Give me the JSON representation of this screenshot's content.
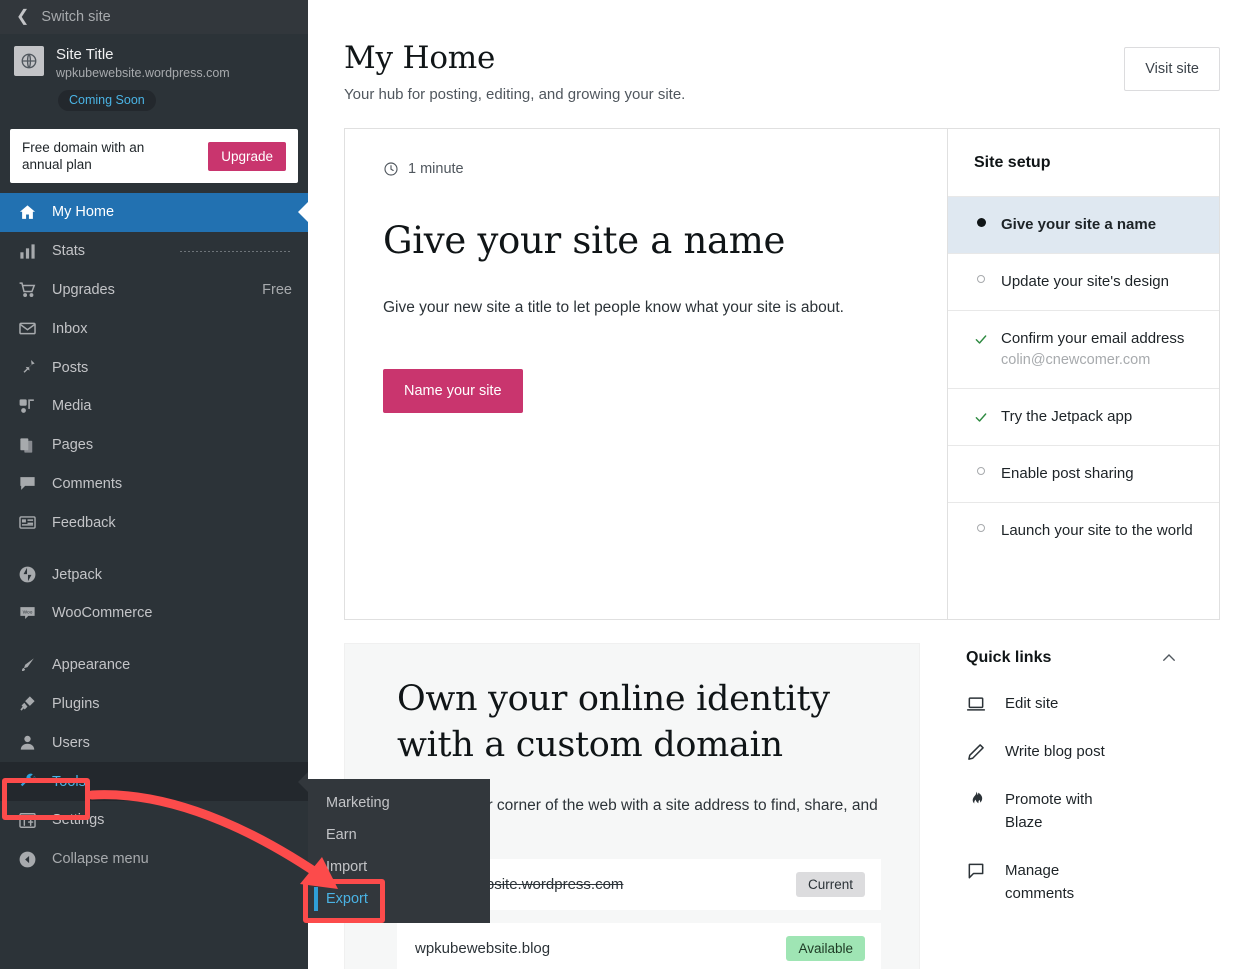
{
  "sidebar": {
    "switch_site": "Switch site",
    "site": {
      "title": "Site Title",
      "url": "wpkubewebsite.wordpress.com",
      "status_badge": "Coming Soon",
      "icon": "globe-icon"
    },
    "upgrade_banner": {
      "text": "Free domain with an annual plan",
      "button": "Upgrade"
    },
    "items": [
      {
        "label": "My Home",
        "icon": "home-icon",
        "active": true,
        "meta": ""
      },
      {
        "label": "Stats",
        "icon": "chart-bars-icon",
        "active": false,
        "meta": ""
      },
      {
        "label": "Upgrades",
        "icon": "cart-icon",
        "active": false,
        "meta": "Free"
      },
      {
        "label": "Inbox",
        "icon": "envelope-icon",
        "active": false,
        "meta": ""
      },
      {
        "label": "Posts",
        "icon": "pin-icon",
        "active": false,
        "meta": ""
      },
      {
        "label": "Media",
        "icon": "media-icon",
        "active": false,
        "meta": ""
      },
      {
        "label": "Pages",
        "icon": "pages-icon",
        "active": false,
        "meta": ""
      },
      {
        "label": "Comments",
        "icon": "comment-icon",
        "active": false,
        "meta": ""
      },
      {
        "label": "Feedback",
        "icon": "feedback-icon",
        "active": false,
        "meta": ""
      },
      {
        "label": "Jetpack",
        "icon": "jetpack-icon",
        "active": false,
        "meta": ""
      },
      {
        "label": "WooCommerce",
        "icon": "woocommerce-icon",
        "active": false,
        "meta": ""
      },
      {
        "label": "Appearance",
        "icon": "brush-icon",
        "active": false,
        "meta": ""
      },
      {
        "label": "Plugins",
        "icon": "plug-icon",
        "active": false,
        "meta": ""
      },
      {
        "label": "Users",
        "icon": "user-icon",
        "active": false,
        "meta": ""
      },
      {
        "label": "Tools",
        "icon": "wrench-icon",
        "active": false,
        "meta": ""
      },
      {
        "label": "Settings",
        "icon": "sliders-icon",
        "active": false,
        "meta": ""
      },
      {
        "label": "Collapse menu",
        "icon": "collapse-icon",
        "active": false,
        "meta": ""
      }
    ]
  },
  "submenu": {
    "items": [
      {
        "label": "Marketing",
        "current": false
      },
      {
        "label": "Earn",
        "current": false
      },
      {
        "label": "Import",
        "current": false
      },
      {
        "label": "Export",
        "current": true
      }
    ]
  },
  "header": {
    "title": "My Home",
    "subtitle": "Your hub for posting, editing, and growing your site.",
    "visit_site": "Visit site"
  },
  "task_card": {
    "time_icon": "clock-icon",
    "time": "1 minute",
    "title": "Give your site a name",
    "description": "Give your new site a title to let people know what your site is about.",
    "button": "Name your site"
  },
  "site_setup": {
    "heading": "Site setup",
    "items": [
      {
        "label": "Give your site a name",
        "state": "current",
        "sub": ""
      },
      {
        "label": "Update your site's design",
        "state": "pending",
        "sub": ""
      },
      {
        "label": "Confirm your email address",
        "state": "done",
        "sub": "colin@cnewcomer.com"
      },
      {
        "label": "Try the Jetpack app",
        "state": "done",
        "sub": ""
      },
      {
        "label": "Enable post sharing",
        "state": "pending",
        "sub": ""
      },
      {
        "label": "Launch your site to the world",
        "state": "pending",
        "sub": ""
      }
    ]
  },
  "domain_card": {
    "title": "Own your online identity with a custom domain",
    "description": "Claim on your corner of the web with a site address to find, share, and follow.",
    "rows": [
      {
        "name": "wpkubewebsite.wordpress.com",
        "badge": "Current",
        "struck": true
      },
      {
        "name": "wpkubewebsite.blog",
        "badge": "Available",
        "struck": false
      }
    ]
  },
  "quick_links": {
    "heading": "Quick links",
    "chevron": "chevron-up-icon",
    "items": [
      {
        "label": "Edit site",
        "icon": "laptop-icon"
      },
      {
        "label": "Write blog post",
        "icon": "pencil-icon"
      },
      {
        "label": "Promote with Blaze",
        "icon": "flame-icon"
      },
      {
        "label": "Manage comments",
        "icon": "comment-bubble-icon"
      }
    ]
  },
  "annotations": {
    "highlight_color": "#fc4b4b",
    "boxes": [
      "tools-menu-item",
      "export-submenu-item"
    ],
    "arrow": "tools-to-export-arrow"
  },
  "colors": {
    "sidebar_bg": "#2c3338",
    "accent_blue": "#2271b1",
    "link_blue": "#4ab3e4",
    "pink": "#c9356e",
    "available_green": "#9fe5b4",
    "highlight_red": "#fc4b4b"
  }
}
